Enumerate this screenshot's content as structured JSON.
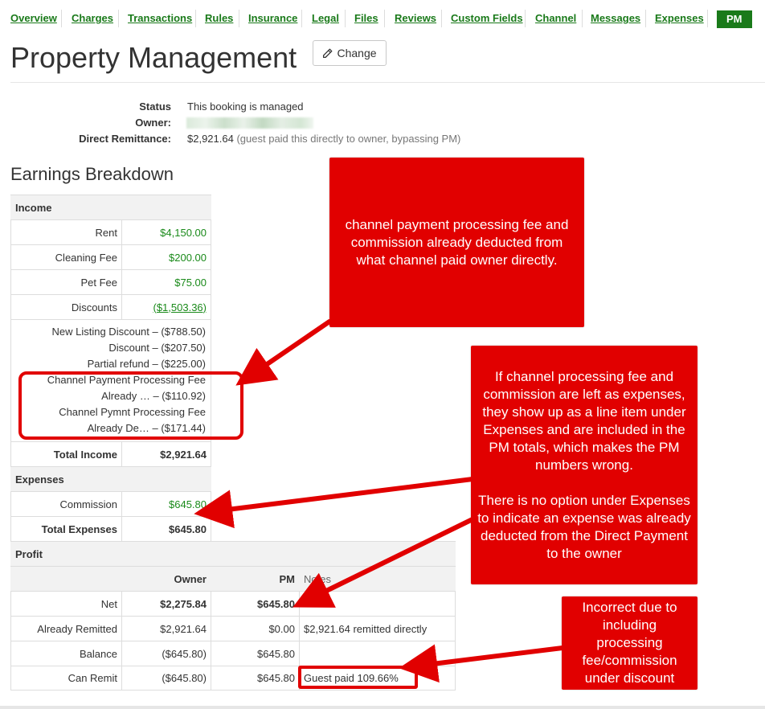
{
  "nav": {
    "tabs": [
      {
        "label": "Overview"
      },
      {
        "label": "Charges"
      },
      {
        "label": "Transactions"
      },
      {
        "label": "Rules"
      },
      {
        "label": "Insurance"
      },
      {
        "label": "Legal"
      },
      {
        "label": "Files"
      },
      {
        "label": "Reviews"
      },
      {
        "label": "Custom Fields"
      },
      {
        "label": "Channel"
      },
      {
        "label": "Messages"
      },
      {
        "label": "Expenses"
      },
      {
        "label": "PM"
      }
    ],
    "active_tab": "PM"
  },
  "header": {
    "title": "Property Management",
    "change_label": "Change",
    "change_icon": "pencil-icon"
  },
  "status": {
    "status_label": "Status",
    "status_value": "This booking is managed",
    "owner_label": "Owner:",
    "remit_label": "Direct Remittance:",
    "remit_value": "$2,921.64",
    "remit_note": "(guest paid this directly to owner, bypassing PM)"
  },
  "breakdown": {
    "title": "Earnings Breakdown",
    "income": {
      "header": "Income",
      "rent_label": "Rent",
      "rent_value": "$4,150.00",
      "cleaning_label": "Cleaning Fee",
      "cleaning_value": "$200.00",
      "pet_label": "Pet Fee",
      "pet_value": "$75.00",
      "discounts_label": "Discounts",
      "discounts_value": "($1,503.36)",
      "discount_lines": [
        "New Listing Discount – ($788.50)",
        "Discount – ($207.50)",
        "Partial refund – ($225.00)",
        "Channel Payment Processing Fee",
        "Already … – ($110.92)",
        "Channel Pymnt Processing Fee",
        "Already De… – ($171.44)"
      ],
      "total_label": "Total Income",
      "total_value": "$2,921.64"
    },
    "expenses": {
      "header": "Expenses",
      "commission_label": "Commission",
      "commission_value": "$645.80",
      "total_label": "Total Expenses",
      "total_value": "$645.80"
    },
    "profit": {
      "header": "Profit",
      "col_owner": "Owner",
      "col_pm": "PM",
      "col_notes": "Notes",
      "rows": [
        {
          "label": "Net",
          "owner": "$2,275.84",
          "pm": "$645.80",
          "notes": ""
        },
        {
          "label": "Already Remitted",
          "owner": "$2,921.64",
          "pm": "$0.00",
          "notes": "$2,921.64 remitted directly"
        },
        {
          "label": "Balance",
          "owner": "($645.80)",
          "pm": "$645.80",
          "notes": ""
        },
        {
          "label": "Can Remit",
          "owner": "($645.80)",
          "pm": "$645.80",
          "notes": "Guest paid 109.66%"
        }
      ]
    }
  },
  "annotations": {
    "callout_1": "channel payment processing fee and commission  already deducted from what channel paid owner directly.",
    "callout_2a": "If channel processing fee and commission are left as expenses, they show up as a line item under Expenses and are included in the PM totals, which makes the PM numbers wrong.",
    "callout_2b": "There is no option under Expenses to indicate an expense was already deducted from the Direct Payment to the owner",
    "callout_3": "Incorrect due to including processing fee/commission under discount",
    "color": "#e10000"
  },
  "colors": {
    "accent_green": "#1a7a1a",
    "value_green": "#1a8a1a",
    "annotation_red": "#e10000"
  }
}
